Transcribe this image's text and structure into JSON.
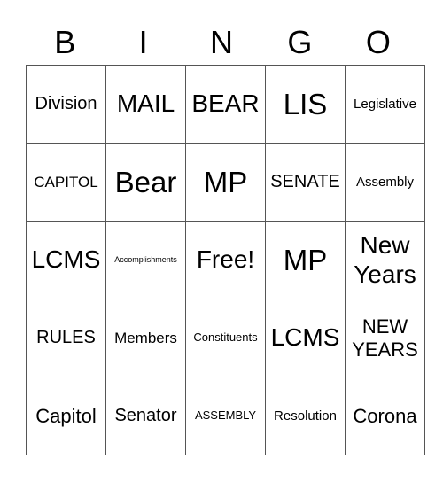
{
  "header": [
    "B",
    "I",
    "N",
    "G",
    "O"
  ],
  "rows": [
    [
      {
        "text": "Division",
        "size": "s-m"
      },
      {
        "text": "MAIL",
        "size": "s-l"
      },
      {
        "text": "BEAR",
        "size": "s-l"
      },
      {
        "text": "LIS",
        "size": "s-xl"
      },
      {
        "text": "Legislative",
        "size": "s-s"
      }
    ],
    [
      {
        "text": "CAPITOL",
        "size": "s-sm"
      },
      {
        "text": "Bear",
        "size": "s-xl"
      },
      {
        "text": "MP",
        "size": "s-xl"
      },
      {
        "text": "SENATE",
        "size": "s-m"
      },
      {
        "text": "Assembly",
        "size": "s-s"
      }
    ],
    [
      {
        "text": "LCMS",
        "size": "s-l"
      },
      {
        "text": "Accomplishments",
        "size": "s-xxs"
      },
      {
        "text": "Free!",
        "size": "s-l"
      },
      {
        "text": "MP",
        "size": "s-xl"
      },
      {
        "text": "New Years",
        "size": "s-l"
      }
    ],
    [
      {
        "text": "RULES",
        "size": "s-m"
      },
      {
        "text": "Members",
        "size": "s-sm"
      },
      {
        "text": "Constituents",
        "size": "s-xs"
      },
      {
        "text": "LCMS",
        "size": "s-l"
      },
      {
        "text": "NEW YEARS",
        "size": "s-ml"
      }
    ],
    [
      {
        "text": "Capitol",
        "size": "s-ml"
      },
      {
        "text": "Senator",
        "size": "s-m"
      },
      {
        "text": "ASSEMBLY",
        "size": "s-xs"
      },
      {
        "text": "Resolution",
        "size": "s-s"
      },
      {
        "text": "Corona",
        "size": "s-ml"
      }
    ]
  ]
}
